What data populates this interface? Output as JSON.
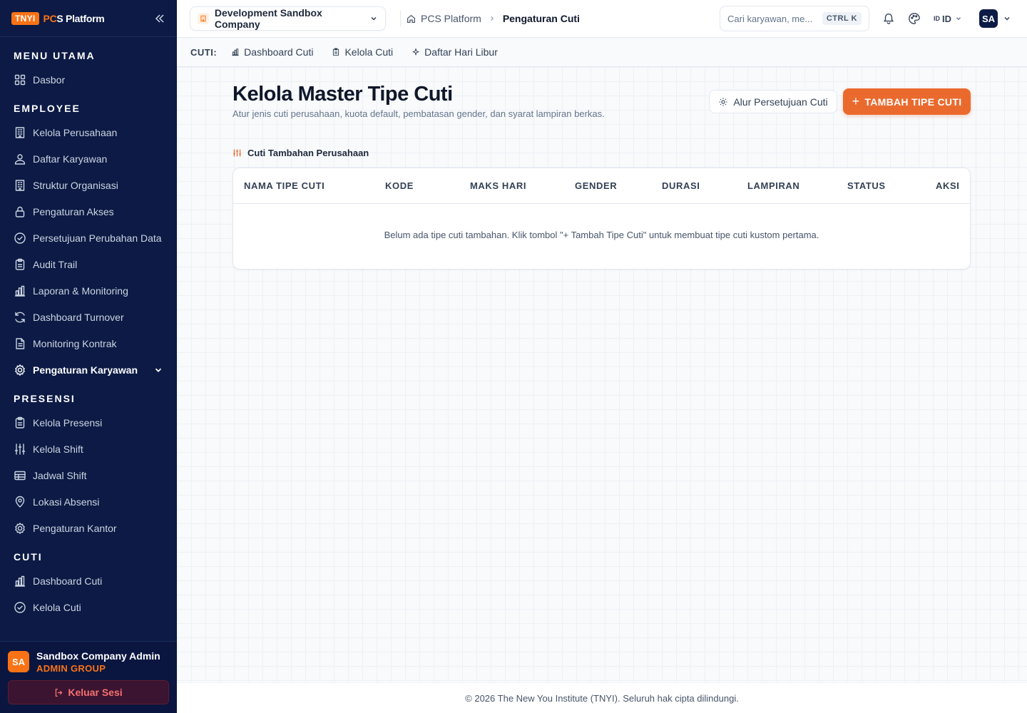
{
  "brand": {
    "badge": "TNYI",
    "name_prefix": "PC",
    "name_suffix": "S Platform"
  },
  "sidebar": {
    "sections": [
      {
        "title": "MENU UTAMA",
        "items": [
          {
            "label": "Dasbor",
            "icon": "grid-icon"
          }
        ]
      },
      {
        "title": "EMPLOYEE",
        "items": [
          {
            "label": "Kelola Perusahaan",
            "icon": "building-icon"
          },
          {
            "label": "Daftar Karyawan",
            "icon": "users-icon"
          },
          {
            "label": "Struktur Organisasi",
            "icon": "building-icon"
          },
          {
            "label": "Pengaturan Akses",
            "icon": "lock-icon"
          },
          {
            "label": "Persetujuan Perubahan Data",
            "icon": "check-circle-icon"
          },
          {
            "label": "Audit Trail",
            "icon": "clipboard-icon"
          },
          {
            "label": "Laporan & Monitoring",
            "icon": "bar-chart-icon"
          },
          {
            "label": "Dashboard Turnover",
            "icon": "refresh-icon"
          },
          {
            "label": "Monitoring Kontrak",
            "icon": "document-icon"
          },
          {
            "label": "Pengaturan Karyawan",
            "icon": "gear-icon",
            "active": true
          }
        ]
      },
      {
        "title": "PRESENSI",
        "items": [
          {
            "label": "Kelola Presensi",
            "icon": "clipboard-icon"
          },
          {
            "label": "Kelola Shift",
            "icon": "sliders-icon"
          },
          {
            "label": "Jadwal Shift",
            "icon": "table-icon"
          },
          {
            "label": "Lokasi Absensi",
            "icon": "map-pin-icon"
          },
          {
            "label": "Pengaturan Kantor",
            "icon": "gear-icon"
          }
        ]
      },
      {
        "title": "CUTI",
        "items": [
          {
            "label": "Dashboard Cuti",
            "icon": "bar-chart-icon"
          },
          {
            "label": "Kelola Cuti",
            "icon": "check-circle-icon"
          }
        ]
      }
    ],
    "user": {
      "initials": "SA",
      "name": "Sandbox Company Admin",
      "role": "ADMIN GROUP"
    },
    "logout_label": "Keluar Sesi"
  },
  "header": {
    "company": "Development Sandbox Company",
    "breadcrumb": {
      "home": "PCS Platform",
      "current": "Pengaturan Cuti"
    },
    "search": {
      "placeholder": "Cari karyawan, me...",
      "shortcut": "CTRL K"
    },
    "lang": {
      "flag": "ID",
      "label": "ID"
    },
    "avatar_initials": "SA"
  },
  "subnav": {
    "label": "CUTI:",
    "items": [
      {
        "label": "Dashboard Cuti",
        "icon": "bar-chart-icon"
      },
      {
        "label": "Kelola Cuti",
        "icon": "clipboard-icon"
      },
      {
        "label": "Daftar Hari Libur",
        "icon": "sparkle-icon"
      }
    ]
  },
  "main": {
    "title": "Kelola Master Tipe Cuti",
    "subtitle": "Atur jenis cuti perusahaan, kuota default, pembatasan gender, dan syarat lampiran berkas.",
    "flow_button": "Alur Persetujuan Cuti",
    "add_button": "TAMBAH TIPE CUTI",
    "section_label": "Cuti Tambahan Perusahaan",
    "table": {
      "columns": [
        "NAMA TIPE CUTI",
        "KODE",
        "MAKS HARI",
        "GENDER",
        "DURASI",
        "LAMPIRAN",
        "STATUS",
        "AKSI"
      ],
      "rows": [],
      "empty_message": "Belum ada tipe cuti tambahan. Klik tombol \"+ Tambah Tipe Cuti\" untuk membuat tipe cuti kustom pertama."
    }
  },
  "footer": {
    "text": "© 2026 The New You Institute (TNYI). Seluruh hak cipta dilindungi."
  },
  "colors": {
    "sidebar_bg": "#0c1a45",
    "accent": "#ea6a2e",
    "logout_text": "#f87171"
  }
}
